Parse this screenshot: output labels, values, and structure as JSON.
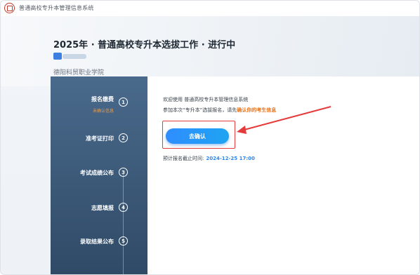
{
  "header": {
    "system_title": "普通高校专升本管理信息系统",
    "logo_icon": "university-seal-icon"
  },
  "hero": {
    "title": "2025年 · 普通高校专升本选拔工作 · 进行中",
    "school": "德阳科贸职业学院"
  },
  "sidebar": {
    "steps": [
      {
        "number": "1",
        "label": "报名缴费",
        "sub": "未确认信息",
        "active": true
      },
      {
        "number": "2",
        "label": "准考证打印"
      },
      {
        "number": "3",
        "label": "考试成绩公布"
      },
      {
        "number": "4",
        "label": "志愿填报"
      },
      {
        "number": "5",
        "label": "录取结果公布"
      }
    ]
  },
  "main": {
    "welcome": "欢迎使用 普通高校专升本管理信息系统",
    "invite_prefix": "参加本次“专升本”选拔报名，请先",
    "invite_link": "确认你的考生信息",
    "confirm_button": "去确认",
    "deadline_label": "预计报名截止时间:",
    "deadline_value": "2024-12-25 17:00"
  },
  "colors": {
    "accent_blue": "#2f8dff",
    "warning_orange": "#e8731c",
    "highlight_red": "#e53b3b",
    "sidebar_blue": "#3c5a7a"
  }
}
